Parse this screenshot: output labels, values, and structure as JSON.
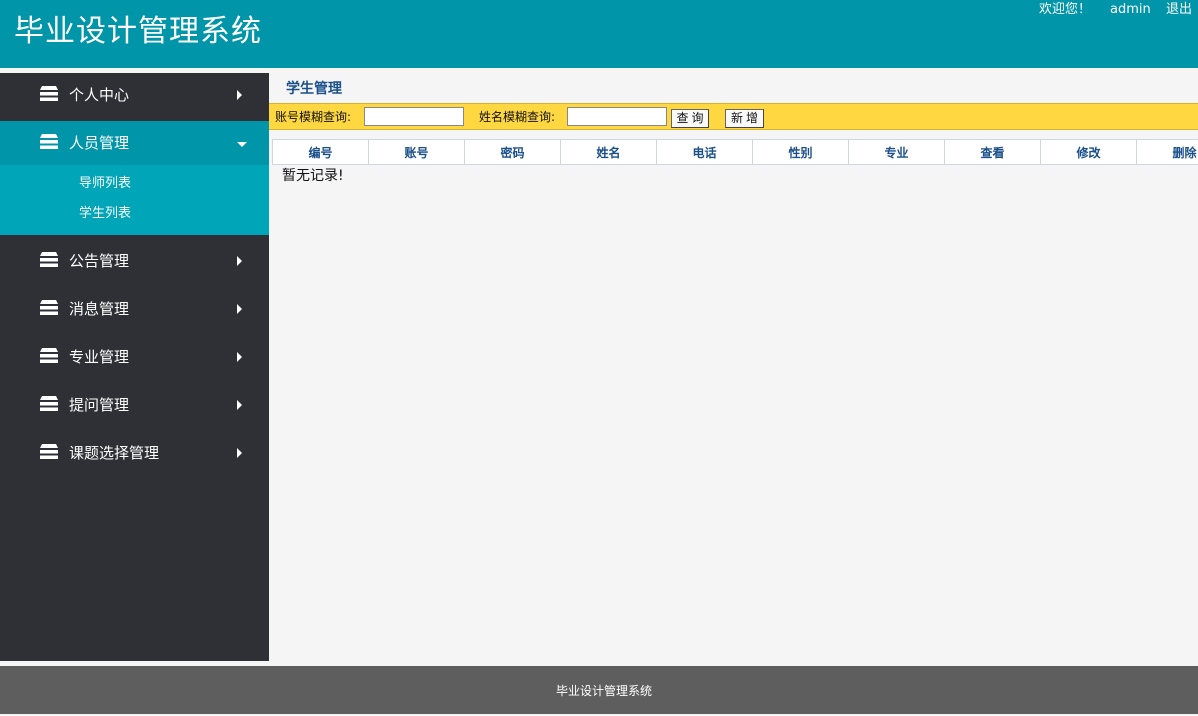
{
  "header": {
    "title": "毕业设计管理系统",
    "welcome": "欢迎您！",
    "username": "admin",
    "logout": "退出"
  },
  "sidebar": {
    "items": [
      {
        "label": "个人中心",
        "icon": "stack-icon",
        "expanded": false
      },
      {
        "label": "人员管理",
        "icon": "stack-icon",
        "expanded": true,
        "children": [
          {
            "label": "导师列表"
          },
          {
            "label": "学生列表"
          }
        ]
      },
      {
        "label": "公告管理",
        "icon": "stack-icon",
        "expanded": false
      },
      {
        "label": "消息管理",
        "icon": "stack-icon",
        "expanded": false
      },
      {
        "label": "专业管理",
        "icon": "stack-icon",
        "expanded": false
      },
      {
        "label": "提问管理",
        "icon": "stack-icon",
        "expanded": false
      },
      {
        "label": "课题选择管理",
        "icon": "stack-icon",
        "expanded": false
      }
    ]
  },
  "main": {
    "page_title": "学生管理",
    "search": {
      "account_label": "账号模糊查询:",
      "account_value": "",
      "name_label": "姓名模糊查询:",
      "name_value": "",
      "query_button": "查询",
      "add_button": "新增"
    },
    "table": {
      "columns": [
        "编号",
        "账号",
        "密码",
        "姓名",
        "电话",
        "性别",
        "专业",
        "查看",
        "修改",
        "删除"
      ],
      "empty_message": "暂无记录!"
    }
  },
  "footer": {
    "text": "毕业设计管理系统"
  },
  "colors": {
    "header_bg": "#0095a8",
    "sidebar_bg": "#2f3036",
    "active_item_bg": "#0095a8",
    "submenu_bg": "#00a5b8",
    "search_bar_bg": "#ffd740",
    "footer_bg": "#5e5e5e",
    "header_text": "#1a4f8a"
  }
}
